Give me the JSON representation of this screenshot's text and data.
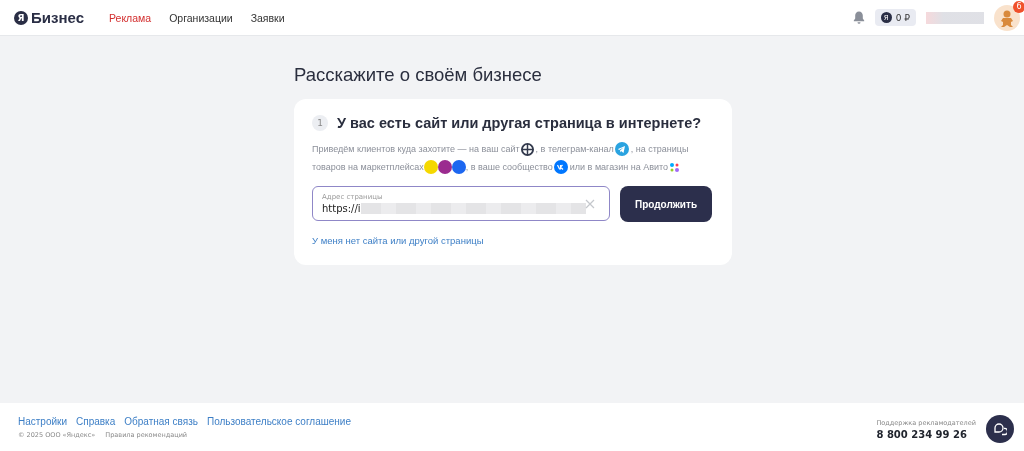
{
  "header": {
    "logo_mark": "Я",
    "logo_text": "Бизнес",
    "nav": [
      {
        "label": "Реклама",
        "selected": true
      },
      {
        "label": "Организации",
        "selected": false
      },
      {
        "label": "Заявки",
        "selected": false
      }
    ],
    "balance": {
      "mark": "Я",
      "amount": "0 ₽"
    },
    "avatar_badge": "6"
  },
  "page_title": "Расскажите о своём бизнесе",
  "step": {
    "number": "1",
    "question": "У вас есть сайт или другая страница в интернете?",
    "description_lines": [
      [
        {
          "text": "Приведём клиентов куда захотите — на ваш сайт",
          "icons": [
            {
              "kind": "globe"
            }
          ]
        },
        {
          "text": ", в телеграм-канал",
          "icons": [
            {
              "kind": "telegram"
            }
          ]
        },
        {
          "text": ", на страницы"
        }
      ],
      [
        {
          "text": "товаров на маркетплейсах",
          "icons": [
            {
              "kind": "marketplace",
              "color": "#f5d800"
            },
            {
              "kind": "marketplace",
              "color": "#9b2b8f"
            },
            {
              "kind": "marketplace",
              "color": "#1d67f0"
            }
          ]
        },
        {
          "text": ", в ваше сообщество",
          "icons": [
            {
              "kind": "vk"
            }
          ]
        },
        {
          "text": "или в магазин на Авито",
          "icons": [
            {
              "kind": "dots"
            }
          ]
        }
      ]
    ],
    "field": {
      "label": "Адрес страницы",
      "value": "https://i"
    },
    "button": "Продолжить",
    "link": "У меня нет сайта или другой страницы"
  },
  "footer": {
    "links": [
      "Настройки",
      "Справка",
      "Обратная связь",
      "Пользовательское соглашение"
    ],
    "copyright": "© 2025 ООО «Яндекс»",
    "rules": "Правила рекомендаций",
    "support_label": "Поддержка рекламодателей",
    "support_phone": "8 800 234 99 26"
  }
}
